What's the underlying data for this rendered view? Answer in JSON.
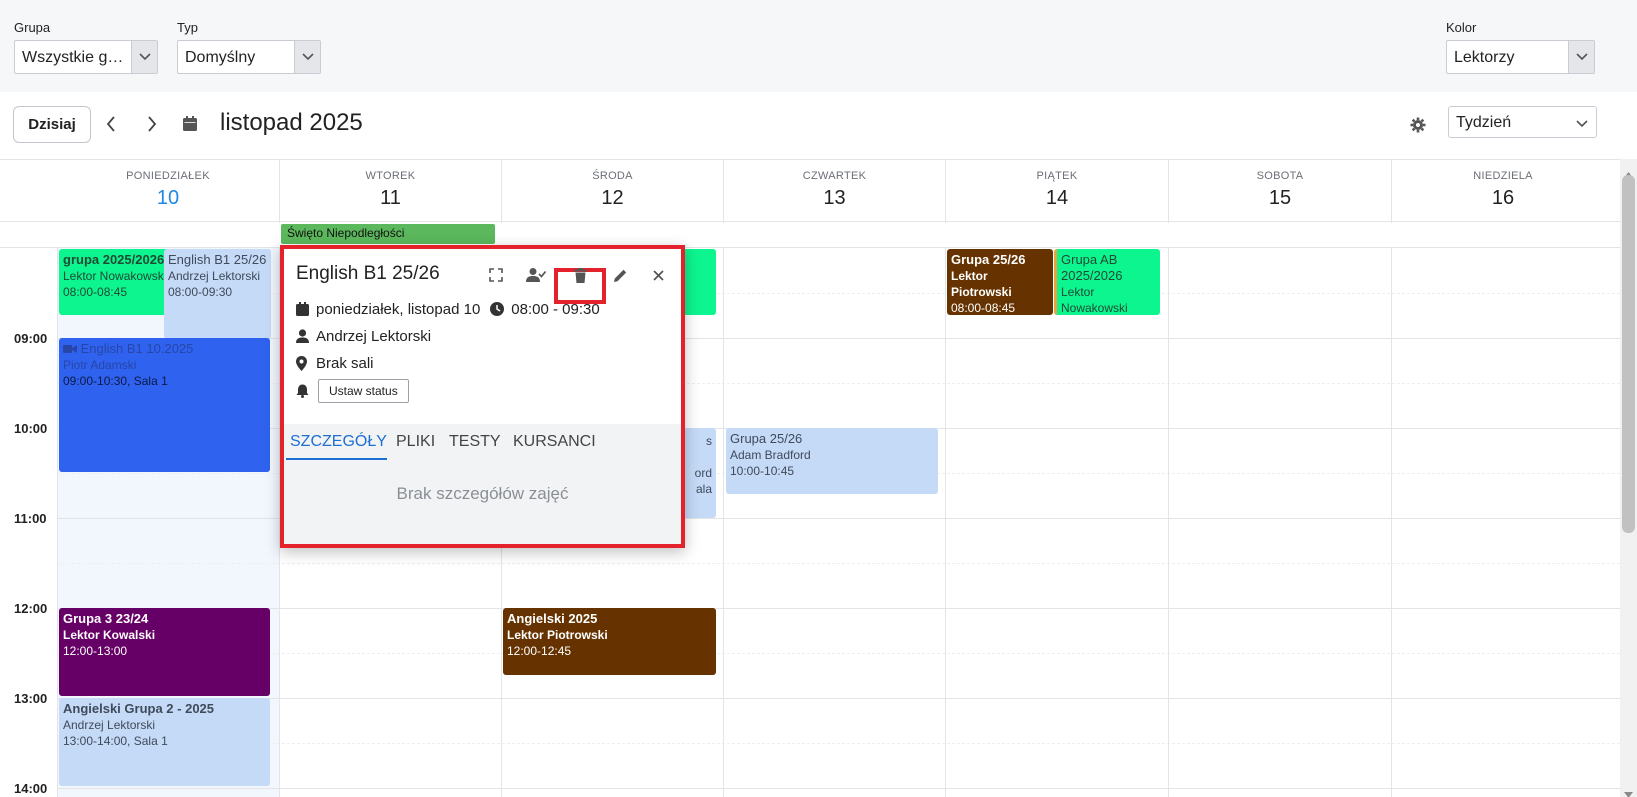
{
  "filters": {
    "group": {
      "label": "Grupa",
      "value": "Wszystkie gru..."
    },
    "type": {
      "label": "Typ",
      "value": "Domyślny"
    },
    "color": {
      "label": "Kolor",
      "value": "Lektorzy"
    }
  },
  "toolbar": {
    "today_label": "Dzisiaj",
    "month_title": "listopad 2025",
    "view_value": "Tydzień"
  },
  "days": [
    {
      "name": "PONIEDZIAŁEK",
      "num": "10",
      "today": true
    },
    {
      "name": "WTOREK",
      "num": "11"
    },
    {
      "name": "ŚRODA",
      "num": "12"
    },
    {
      "name": "CZWARTEK",
      "num": "13"
    },
    {
      "name": "PIĄTEK",
      "num": "14"
    },
    {
      "name": "SOBOTA",
      "num": "15"
    },
    {
      "name": "NIEDZIELA",
      "num": "16"
    }
  ],
  "allday": {
    "title": "Święto Niepodległości"
  },
  "hours": [
    "09:00",
    "10:00",
    "11:00",
    "12:00",
    "13:00",
    "14:00"
  ],
  "events": {
    "mon_grupa_2025": {
      "title": "grupa 2025/2026",
      "line1": "Lektor Nowakowski",
      "line2": "08:00-08:45"
    },
    "mon_english_b1": {
      "title": "English B1 25/26",
      "line1": "Andrzej Lektorski",
      "line2": "08:00-09:30"
    },
    "mon_english_online": {
      "title": "English B1 10.2025",
      "line1": "Piotr Adamski",
      "line2": "09:00-10:30, Sala 1"
    },
    "mon_grupa3": {
      "title": "Grupa 3 23/24",
      "line1": "Lektor Kowalski",
      "line2": "12:00-13:00"
    },
    "mon_angielski_g2": {
      "title": "Angielski Grupa 2 - 2025",
      "line1": "Andrzej Lektorski",
      "line2": "13:00-14:00, Sala 1"
    },
    "wed_peek": {
      "t1": "s",
      "t2": "ord",
      "t3": "ala"
    },
    "wed_angielski": {
      "title": "Angielski 2025",
      "line1": "Lektor Piotrowski",
      "line2": "12:00-12:45"
    },
    "thu_grupa": {
      "title": "Grupa 25/26",
      "line1": "Adam Bradford",
      "line2": "10:00-10:45"
    },
    "fri_grupa": {
      "title": "Grupa 25/26",
      "line1": "Lektor Piotrowski",
      "line2": "08:00-08:45"
    },
    "fri_grupa_ab": {
      "title": "Grupa AB 2025/2026",
      "line1": "Lektor Nowakowski"
    }
  },
  "popup": {
    "title": "English B1 25/26",
    "date": "poniedziałek, listopad 10",
    "time": "08:00 - 09:30",
    "teacher": "Andrzej Lektorski",
    "room": "Brak sali",
    "status_button": "Ustaw status",
    "tabs": [
      "SZCZEGÓŁY",
      "PLIKI",
      "TESTY",
      "KURSANCI"
    ],
    "empty_text": "Brak szczegółów zajęć"
  },
  "colors": {
    "accent_blue": "#1e88e5",
    "highlight_red": "#e3222b",
    "event_green": "#0df58f",
    "event_lightblue": "#c5daf7",
    "event_blue": "#2f62ef",
    "event_purple": "#660066",
    "event_brown": "#663300",
    "allday_green": "#5cb85c"
  }
}
